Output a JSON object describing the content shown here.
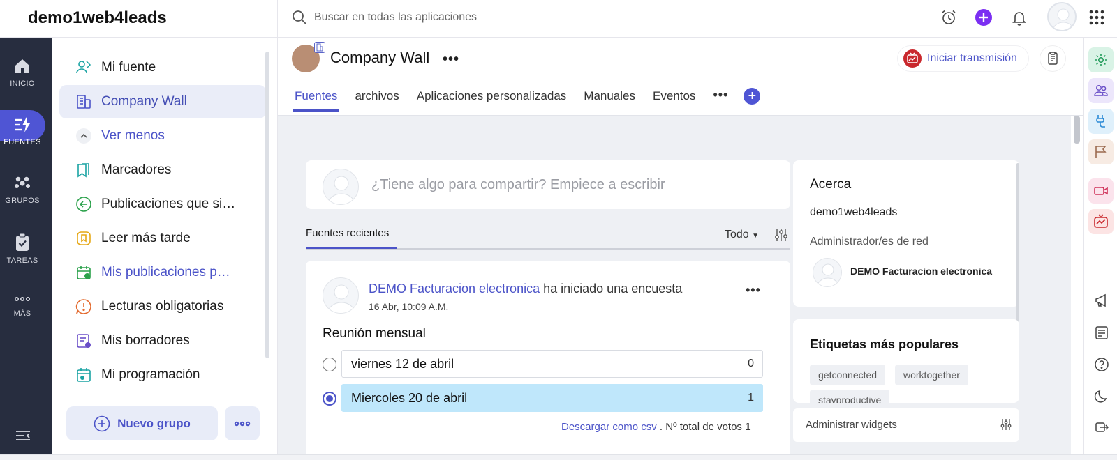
{
  "app": {
    "brand": "demo1web4leads",
    "search_placeholder": "Buscar en todas las aplicaciones"
  },
  "rail": {
    "items": [
      {
        "label": "INICIO",
        "icon": "home-icon"
      },
      {
        "label": "FUENTES",
        "icon": "feeds-icon",
        "active": true
      },
      {
        "label": "GRUPOS",
        "icon": "groups-icon"
      },
      {
        "label": "TAREAS",
        "icon": "tasks-icon"
      },
      {
        "label": "MÁS",
        "icon": "more-horizontal-icon"
      }
    ]
  },
  "feednav": {
    "items": [
      {
        "label": "Mi fuente",
        "icon": "my-feed-icon"
      },
      {
        "label": "Company Wall",
        "icon": "company-wall-icon",
        "active": true
      },
      {
        "label": "Ver menos",
        "icon": "chevron-up-icon"
      },
      {
        "label": "Marcadores",
        "icon": "bookmarks-icon"
      },
      {
        "label": "Publicaciones que si…",
        "icon": "followed-posts-icon"
      },
      {
        "label": "Leer más tarde",
        "icon": "read-later-icon"
      },
      {
        "label": "Mis publicaciones p…",
        "icon": "scheduled-posts-icon"
      },
      {
        "label": "Lecturas obligatorias",
        "icon": "mandatory-reads-icon"
      },
      {
        "label": "Mis borradores",
        "icon": "drafts-icon"
      },
      {
        "label": "Mi programación",
        "icon": "my-schedule-icon"
      }
    ],
    "new_group": "Nuevo grupo"
  },
  "header": {
    "title": "Company Wall",
    "live_button": "Iniciar transmisión",
    "tabs": [
      "Fuentes",
      "archivos",
      "Aplicaciones personalizadas",
      "Manuales",
      "Eventos"
    ]
  },
  "composer": {
    "placeholder": "¿Tiene algo para compartir? Empiece a escribir"
  },
  "recent": {
    "tab_label": "Fuentes recientes",
    "filter_value": "Todo"
  },
  "post": {
    "author": "DEMO Facturacion electronica",
    "action": "ha iniciado una encuesta",
    "time": "16 Abr, 10:09 A.M.",
    "question": "Reunión mensual",
    "options": [
      {
        "label": "viernes 12 de abril",
        "count": "0",
        "selected": false
      },
      {
        "label": "Miercoles 20 de abril",
        "count": "1",
        "selected": true
      }
    ],
    "download_link": "Descargar como csv",
    "total_label": "Nº total de votos",
    "total_votes": "1"
  },
  "about": {
    "title": "Acerca",
    "network": "demo1web4leads",
    "admins_label": "Administrador/es de red",
    "admin_name": "DEMO Facturacion electronica"
  },
  "tags": {
    "title": "Etiquetas más populares",
    "items": [
      "getconnected",
      "worktogether",
      "stayproductive"
    ]
  },
  "widgets": {
    "manage_label": "Administrar widgets"
  },
  "colors": {
    "accent": "#4b53c8",
    "rail_bg": "#272d3f",
    "live_red": "#c9282d",
    "poll_selected": "#bfe7fb"
  }
}
